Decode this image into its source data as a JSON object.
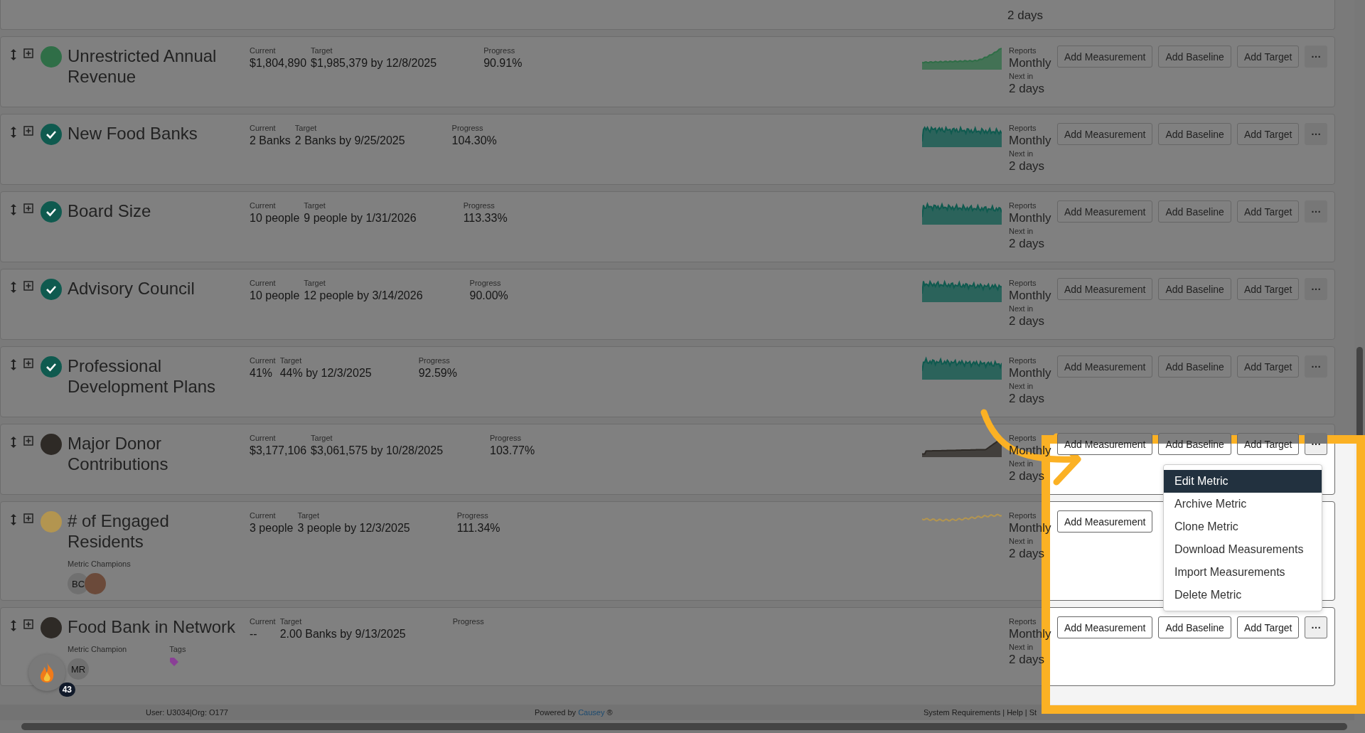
{
  "top_card": {
    "next_in": "2 days"
  },
  "metrics": [
    {
      "title": "Unrestricted Annual Revenue",
      "status": {
        "kind": "dot",
        "color": "#2f6e47"
      },
      "current_label": "Current",
      "current": "$1,804,890",
      "target_label": "Target",
      "target": "$1,985,379 by 12/8/2025",
      "progress_label": "Progress",
      "progress": "90.91%",
      "sparkline": {
        "kind": "rising"
      },
      "reports_label": "Reports",
      "reports": "Monthly",
      "next_label": "Next in",
      "next": "2 days",
      "actions": [
        {
          "kind": "text",
          "label": "Add Measurement"
        },
        {
          "kind": "text",
          "label": "Add Baseline"
        },
        {
          "kind": "text",
          "label": "Add Target"
        },
        {
          "kind": "more",
          "label": "···"
        }
      ]
    },
    {
      "title": "New Food Banks",
      "status": {
        "kind": "check",
        "color": "#0f5a4f"
      },
      "current_label": "Current",
      "current": "2 Banks",
      "target_label": "Target",
      "target": "2 Banks by 9/25/2025",
      "progress_label": "Progress",
      "progress": "104.30%",
      "sparkline": {
        "kind": "noisy"
      },
      "reports_label": "Reports",
      "reports": "Monthly",
      "next_label": "Next in",
      "next": "2 days",
      "actions": [
        {
          "kind": "text",
          "label": "Add Measurement"
        },
        {
          "kind": "text",
          "label": "Add Baseline"
        },
        {
          "kind": "text",
          "label": "Add Target"
        },
        {
          "kind": "more",
          "label": "···"
        }
      ]
    },
    {
      "title": "Board Size",
      "status": {
        "kind": "check",
        "color": "#0f5a4f"
      },
      "current_label": "Current",
      "current": "10 people",
      "target_label": "Target",
      "target": "9 people by 1/31/2026",
      "progress_label": "Progress",
      "progress": "113.33%",
      "sparkline": {
        "kind": "noisy"
      },
      "reports_label": "Reports",
      "reports": "Monthly",
      "next_label": "Next in",
      "next": "2 days",
      "actions": [
        {
          "kind": "text",
          "label": "Add Measurement"
        },
        {
          "kind": "text",
          "label": "Add Baseline"
        },
        {
          "kind": "text",
          "label": "Add Target"
        },
        {
          "kind": "more",
          "label": "···"
        }
      ]
    },
    {
      "title": "Advisory Council",
      "status": {
        "kind": "check",
        "color": "#0f5a4f"
      },
      "current_label": "Current",
      "current": "10 people",
      "target_label": "Target",
      "target": "12 people by 3/14/2026",
      "progress_label": "Progress",
      "progress": "90.00%",
      "sparkline": {
        "kind": "noisy"
      },
      "reports_label": "Reports",
      "reports": "Monthly",
      "next_label": "Next in",
      "next": "2 days",
      "actions": [
        {
          "kind": "text",
          "label": "Add Measurement"
        },
        {
          "kind": "text",
          "label": "Add Baseline"
        },
        {
          "kind": "text",
          "label": "Add Target"
        },
        {
          "kind": "more",
          "label": "···"
        }
      ]
    },
    {
      "title": "Professional Development Plans",
      "status": {
        "kind": "check",
        "color": "#0f5a4f"
      },
      "current_label": "Current",
      "current": "41%",
      "target_label": "Target",
      "target": "44% by 12/3/2025",
      "progress_label": "Progress",
      "progress": "92.59%",
      "sparkline": {
        "kind": "noisy"
      },
      "reports_label": "Reports",
      "reports": "Monthly",
      "next_label": "Next in",
      "next": "2 days",
      "actions": [
        {
          "kind": "text",
          "label": "Add Measurement"
        },
        {
          "kind": "text",
          "label": "Add Baseline"
        },
        {
          "kind": "text",
          "label": "Add Target"
        },
        {
          "kind": "more",
          "label": "···"
        }
      ]
    },
    {
      "title": "Major Donor Contributions",
      "status": {
        "kind": "dot",
        "color": "#2e2a26"
      },
      "current_label": "Current",
      "current": "$3,177,106",
      "target_label": "Target",
      "target": "$3,061,575 by 10/28/2025",
      "progress_label": "Progress",
      "progress": "103.77%",
      "sparkline": {
        "kind": "spike"
      },
      "reports_label": "Reports",
      "reports": "Monthly",
      "next_label": "Next in",
      "next": "2 days",
      "actions": [
        {
          "kind": "text",
          "label": "Add Measurement"
        },
        {
          "kind": "text",
          "label": "Add Baseline"
        },
        {
          "kind": "text",
          "label": "Add Target"
        },
        {
          "kind": "more",
          "label": "···"
        }
      ]
    },
    {
      "title": "# of Engaged Residents",
      "status": {
        "kind": "dot",
        "color": "#b39550"
      },
      "current_label": "Current",
      "current": "3 people",
      "target_label": "Target",
      "target": "3 people by 12/3/2025",
      "progress_label": "Progress",
      "progress": "111.34%",
      "sparkline": {
        "kind": "flat"
      },
      "reports_label": "Reports",
      "reports": "Monthly",
      "next_label": "Next in",
      "next": "2 days",
      "actions": [
        {
          "kind": "text",
          "label": "Add Measurement"
        }
      ],
      "champions": {
        "label": "Metric Champions",
        "people": [
          {
            "kind": "initials",
            "text": "BC"
          },
          {
            "kind": "photo"
          }
        ]
      }
    },
    {
      "title": "Food Bank in Network",
      "status": {
        "kind": "dot",
        "color": "#2e2a26"
      },
      "current_label": "Current",
      "current": "--",
      "target_label": "Target",
      "target": "2.00 Banks by 9/13/2025",
      "progress_label": "Progress",
      "reports_label": "Reports",
      "reports": "Monthly",
      "next_label": "Next in",
      "next": "2 days",
      "actions": [
        {
          "kind": "text",
          "label": "Add Measurement"
        },
        {
          "kind": "text",
          "label": "Add Baseline"
        },
        {
          "kind": "text",
          "label": "Add Target"
        },
        {
          "kind": "more",
          "label": "···"
        }
      ],
      "champions": {
        "label": "Metric Champion",
        "people": [
          {
            "kind": "initials",
            "text": "MR"
          }
        ]
      },
      "tags": {
        "label": "Tags",
        "items": [
          {
            "color": "#8a3f96"
          }
        ]
      }
    }
  ],
  "menu": {
    "items": [
      {
        "label": "Edit Metric",
        "selected": true
      },
      {
        "label": "Archive Metric",
        "selected": false
      },
      {
        "label": "Clone Metric",
        "selected": false
      },
      {
        "label": "Download Measurements",
        "selected": false
      },
      {
        "label": "Import Measurements",
        "selected": false
      },
      {
        "label": "Delete Metric",
        "selected": false
      }
    ]
  },
  "streak_badge": {
    "count": "43"
  },
  "footer": {
    "user": "User: U3034|Org: O177",
    "powered_prefix": "Powered by",
    "powered_link": "Causey",
    "powered_suffix": "®",
    "links": "System Requirements | Help | St"
  }
}
